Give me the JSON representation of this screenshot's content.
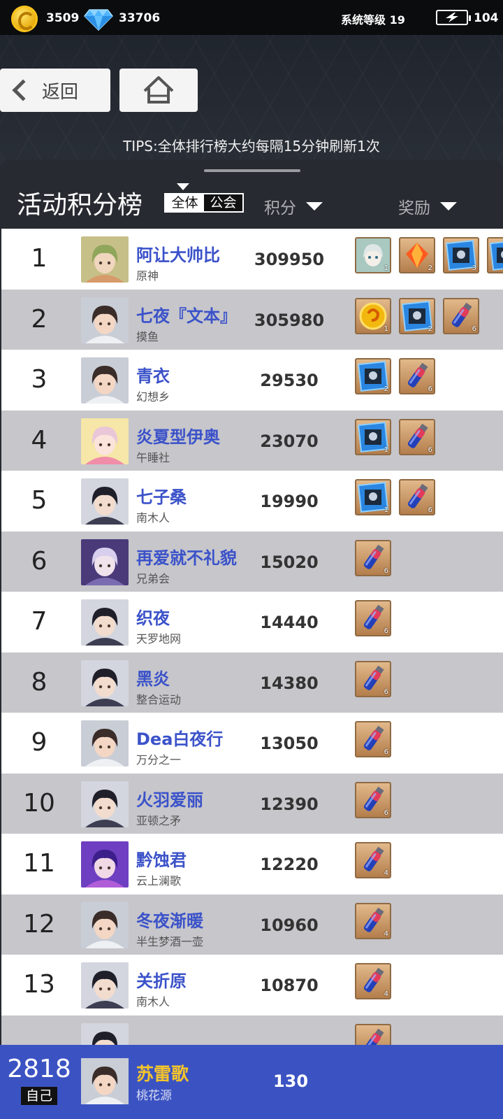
{
  "topbar": {
    "coins": "3509",
    "gems": "33706",
    "system_level": "系统等级 19",
    "stamina": "104"
  },
  "nav": {
    "back_label": "返回"
  },
  "tips": "TIPS:全体排行榜大约每隔15分钟刷新1次",
  "board": {
    "title": "活动积分榜",
    "scope_all": "全体",
    "scope_guild": "公会",
    "col_score": "积分",
    "col_reward": "奖励"
  },
  "rows": [
    {
      "rank": "1",
      "name": "阿让大帅比",
      "guild": "原神",
      "score": "309950",
      "avatar": "art",
      "rewards": [
        {
          "icon": "character-portrait-icon",
          "count": "1"
        },
        {
          "icon": "orange-crystal-icon",
          "count": "2"
        },
        {
          "icon": "blue-card-icon",
          "count": "3"
        },
        {
          "icon": "blue-card-icon",
          "count": ""
        }
      ]
    },
    {
      "rank": "2",
      "name": "七夜『文本』",
      "guild": "摸鱼",
      "score": "305980",
      "avatar": "boy",
      "rewards": [
        {
          "icon": "gold-coin-icon",
          "count": "1"
        },
        {
          "icon": "blue-card-icon",
          "count": "2"
        },
        {
          "icon": "potion-vial-icon",
          "count": "6"
        }
      ]
    },
    {
      "rank": "3",
      "name": "青衣",
      "guild": "幻想乡",
      "score": "29530",
      "avatar": "boy",
      "rewards": [
        {
          "icon": "blue-card-icon",
          "count": "2"
        },
        {
          "icon": "potion-vial-icon",
          "count": "6"
        }
      ]
    },
    {
      "rank": "4",
      "name": "炎夏型伊奥",
      "guild": "午睡社",
      "score": "23070",
      "avatar": "pink",
      "rewards": [
        {
          "icon": "blue-card-icon",
          "count": "1"
        },
        {
          "icon": "potion-vial-icon",
          "count": "6"
        }
      ]
    },
    {
      "rank": "5",
      "name": "七子桑",
      "guild": "南木人",
      "score": "19990",
      "avatar": "girl",
      "rewards": [
        {
          "icon": "blue-card-icon",
          "count": "1"
        },
        {
          "icon": "potion-vial-icon",
          "count": "6"
        }
      ]
    },
    {
      "rank": "6",
      "name": "再爱就不礼貌",
      "guild": "兄弟会",
      "score": "15020",
      "avatar": "purple",
      "rewards": [
        {
          "icon": "potion-vial-icon",
          "count": "6"
        }
      ]
    },
    {
      "rank": "7",
      "name": "织夜",
      "guild": "天罗地网",
      "score": "14440",
      "avatar": "girl",
      "rewards": [
        {
          "icon": "potion-vial-icon",
          "count": "6"
        }
      ]
    },
    {
      "rank": "8",
      "name": "黑炎",
      "guild": "整合运动",
      "score": "14380",
      "avatar": "girl",
      "rewards": [
        {
          "icon": "potion-vial-icon",
          "count": "6"
        }
      ]
    },
    {
      "rank": "9",
      "name": "Dea白夜行",
      "guild": "万分之一",
      "score": "13050",
      "avatar": "boy",
      "rewards": [
        {
          "icon": "potion-vial-icon",
          "count": "6"
        }
      ]
    },
    {
      "rank": "10",
      "name": "火羽爱丽",
      "guild": "亚顿之矛",
      "score": "12390",
      "avatar": "girl",
      "rewards": [
        {
          "icon": "potion-vial-icon",
          "count": "6"
        }
      ]
    },
    {
      "rank": "11",
      "name": "黔蚀君",
      "guild": "云上澜歌",
      "score": "12220",
      "avatar": "violet",
      "rewards": [
        {
          "icon": "potion-vial-icon",
          "count": "4"
        }
      ]
    },
    {
      "rank": "12",
      "name": "冬夜渐暖",
      "guild": "半生梦酒一壶",
      "score": "10960",
      "avatar": "boy",
      "rewards": [
        {
          "icon": "potion-vial-icon",
          "count": "4"
        }
      ]
    },
    {
      "rank": "13",
      "name": "关折原",
      "guild": "南木人",
      "score": "10870",
      "avatar": "girl",
      "rewards": [
        {
          "icon": "potion-vial-icon",
          "count": "4"
        }
      ]
    },
    {
      "rank": "",
      "name": "",
      "guild": "",
      "score": "",
      "avatar": "girl",
      "rewards": [
        {
          "icon": "potion-vial-icon",
          "count": ""
        }
      ]
    }
  ],
  "me": {
    "rank": "2818",
    "tag": "自己",
    "name": "苏雷歌",
    "guild": "桃花源",
    "score": "130",
    "avatar": "boy"
  },
  "colors": {
    "name_blue": "#3b52c9",
    "me_bar": "#3b53c2",
    "me_name": "#f6c52a"
  }
}
